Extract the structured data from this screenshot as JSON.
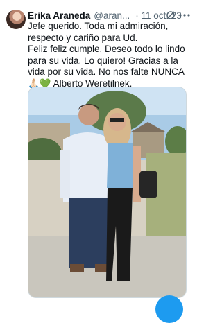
{
  "tweet": {
    "author_name": "Erika Araneda",
    "handle": "@aran...",
    "date": "· 11 oct. 23",
    "text": "Jefe querido. Toda mi admiración, respecto y cariño para Ud.\nFeliz feliz cumple. Deseo todo lo lindo para su vida. Lo quiero! Gracias a la vida por su vida. No nos falte NUNCA🙏🏻💚 Alberto Weretilnek."
  },
  "icons": {
    "grok": "grok-icon",
    "more": "more-options-icon",
    "compose": "compose-fab-icon"
  },
  "colors": {
    "text": "#0f1419",
    "secondary": "#536471",
    "accent": "#1d9bf0"
  }
}
